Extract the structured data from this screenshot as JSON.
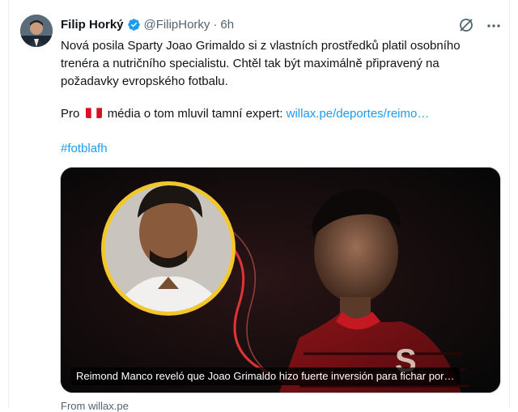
{
  "tweet": {
    "author_name": "Filip Horký",
    "handle": "@FilipHorky",
    "separator": "·",
    "time": "6h",
    "verified": true,
    "text": "Nová posila Sparty Joao Grimaldo si z vlastních prostředků platil osobního trenéra a nutričního specialistu. Chtěl tak být maximálně připravený na požadavky evropského fotbalu.",
    "para2_before": "Pro",
    "para2_after": "média o tom mluvil tamní expert:",
    "link": "willax.pe/deportes/reimo…",
    "hashtag": "#fotblafh"
  },
  "card": {
    "caption": "Reimond Manco reveló que Joao Grimaldo hizo fuerte inversión para fichar por…",
    "source": "From willax.pe"
  },
  "icons": {
    "verified": "verified-badge-icon",
    "grok": "grok-icon",
    "more": "more-options-icon",
    "flag": "peru-flag-icon"
  },
  "colors": {
    "link": "#1d9bf0",
    "secondary_text": "#536471",
    "verified": "#1d9bf0",
    "caption_bg": "#000000"
  }
}
